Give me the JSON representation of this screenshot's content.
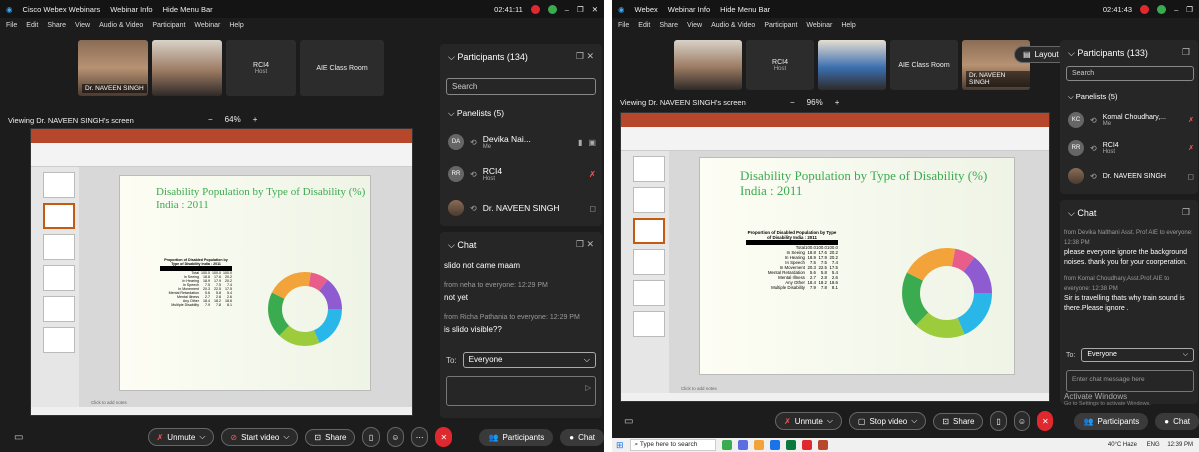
{
  "colors": {
    "accent_green": "#3bab4f",
    "ppt_red": "#b7472a",
    "danger": "#e0282f"
  },
  "left": {
    "titlebar": {
      "app": "Cisco Webex Webinars",
      "info": "Webinar Info",
      "hide": "Hide Menu Bar",
      "time": "02:41:11"
    },
    "menu": [
      "File",
      "Edit",
      "Share",
      "View",
      "Audio & Video",
      "Participant",
      "Webinar",
      "Help"
    ],
    "thumbs": {
      "naveen": "Dr. NAVEEN SINGH",
      "rci": "RCI4",
      "rci_role": "Host",
      "aie": "AIE Class Room"
    },
    "viewing": "Viewing Dr. NAVEEN SINGH's screen",
    "zoom": {
      "minus": "−",
      "value": "64%",
      "plus": "+"
    },
    "participants": {
      "header": "Participants (134)",
      "search_placeholder": "Search",
      "panelists_header": "Panelists (5)",
      "people": [
        {
          "initials": "DA",
          "name": "Devika Nai...",
          "role": "Me"
        },
        {
          "initials": "RR",
          "name": "RCI4",
          "role": "Host"
        },
        {
          "initials": "",
          "name": "Dr. NAVEEN SINGH",
          "role": ""
        }
      ]
    },
    "chat": {
      "header": "Chat",
      "messages": [
        {
          "meta": "",
          "text": "slido not came maam"
        },
        {
          "meta": "from neha to everyone:   12:29 PM",
          "text": "not yet"
        },
        {
          "meta": "from Richa Pathania to everyone:   12:29 PM",
          "text": "is slido visible??"
        }
      ],
      "to_label": "To:",
      "to_value": "Everyone"
    },
    "toolbar": {
      "unmute": "Unmute",
      "start_video": "Start video",
      "share": "Share",
      "participants": "Participants",
      "chat": "Chat"
    }
  },
  "right": {
    "titlebar": {
      "app": "Webex",
      "info": "Webinar Info",
      "hide": "Hide Menu Bar",
      "time": "02:41:43"
    },
    "menu": [
      "File",
      "Edit",
      "Share",
      "View",
      "Audio & Video",
      "Participant",
      "Webinar",
      "Help"
    ],
    "layout": "Layout",
    "thumbs": {
      "rci": "RCI4",
      "rci_role": "Host",
      "aie": "AIE Class Room",
      "naveen": "Dr. NAVEEN SINGH"
    },
    "viewing": "Viewing Dr. NAVEEN SINGH's screen",
    "zoom": {
      "minus": "−",
      "value": "96%",
      "plus": "+"
    },
    "participants": {
      "header": "Participants (133)",
      "search_placeholder": "Search",
      "panelists_header": "Panelists (5)",
      "people": [
        {
          "initials": "KC",
          "name": "Komal Choudhary,...",
          "role": "Me"
        },
        {
          "initials": "RR",
          "name": "RCI4",
          "role": "Host"
        },
        {
          "initials": "",
          "name": "Dr. NAVEEN SINGH",
          "role": ""
        }
      ]
    },
    "chat": {
      "header": "Chat",
      "messages": [
        {
          "meta": "from Devika Nalthani Asst. Prof AIE to everyone:  12:38 PM",
          "text": "please everyone ignore the background noises. thank you for your coorperation."
        },
        {
          "meta": "from Komal Choudhary,Asst.Prof.AIE to everyone:  12:38 PM",
          "text": "Sir is travelling thats why train sound is there.Please ignore ."
        }
      ],
      "to_label": "To:",
      "to_value": "Everyone",
      "input_placeholder": "Enter chat message here"
    },
    "activate": {
      "title": "Activate Windows",
      "sub": "Go to Settings to activate Windows."
    },
    "toolbar": {
      "unmute": "Unmute",
      "stop_video": "Stop video",
      "share": "Share",
      "participants": "Participants",
      "chat": "Chat"
    },
    "taskbar": {
      "search": "Type here to search",
      "weather": "40°C Haze",
      "lang": "ENG",
      "time": "12:39 PM"
    }
  },
  "slide": {
    "title_line1": "Disability Population by Type of Disability (%)",
    "title_line2": "India : 2011",
    "table_title": "Proportion of Disabled Population by Type of Disability India : 2011",
    "rows": [
      [
        "Total",
        "100.0",
        "100.0",
        "100.0"
      ],
      [
        "In Seeing",
        "18.8",
        "17.6",
        "20.2"
      ],
      [
        "In Hearing",
        "18.9",
        "17.9",
        "20.2"
      ],
      [
        "In Speech",
        "7.5",
        "7.5",
        "7.4"
      ],
      [
        "In Movement",
        "20.3",
        "22.5",
        "17.5"
      ],
      [
        "Mental Retardation",
        "5.6",
        "5.8",
        "5.4"
      ],
      [
        "Mental Illness",
        "2.7",
        "2.8",
        "2.6"
      ],
      [
        "Any Other",
        "18.4",
        "18.2",
        "18.6"
      ],
      [
        "Multiple Disability",
        "7.9",
        "7.8",
        "8.1"
      ]
    ],
    "notes": "Click to add notes"
  }
}
